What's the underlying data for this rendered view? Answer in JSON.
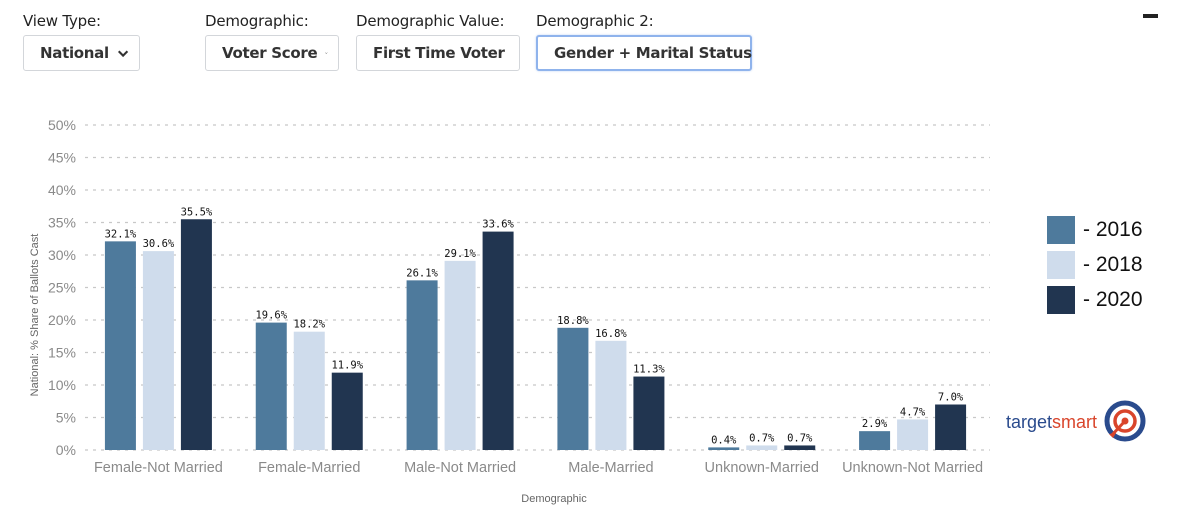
{
  "filters": [
    {
      "label": "View Type:",
      "value": "National"
    },
    {
      "label": "Demographic:",
      "value": "Voter Score"
    },
    {
      "label": "Demographic Value:",
      "value": "First Time Voter"
    },
    {
      "label": "Demographic 2:",
      "value": "Gender + Marital Status"
    }
  ],
  "window": {
    "minimize_icon": "minimize-icon"
  },
  "colors": {
    "s2016": "#4e7a9c",
    "s2018": "#cfdcec",
    "s2020": "#213550",
    "grid": "#c8c8c8",
    "axis_text": "#8a8a8a",
    "logo_blue": "#2a4b8d",
    "logo_red": "#d9452b"
  },
  "logo": {
    "part1": "target",
    "part2": "smart",
    "icon": "target-icon"
  },
  "chart_data": {
    "type": "bar",
    "title": "",
    "xlabel": "Demographic",
    "ylabel": "National: % Share of Ballots Cast",
    "ylim": [
      0,
      50
    ],
    "yticks": [
      "0%",
      "5%",
      "10%",
      "15%",
      "20%",
      "25%",
      "30%",
      "35%",
      "40%",
      "45%",
      "50%"
    ],
    "grid": true,
    "legend_position": "right",
    "categories": [
      "Female-Not Married",
      "Female-Married",
      "Male-Not Married",
      "Male-Married",
      "Unknown-Married",
      "Unknown-Not Married"
    ],
    "series": [
      {
        "name": "- 2016",
        "key": "s2016",
        "values": [
          32.1,
          19.6,
          26.1,
          18.8,
          0.4,
          2.9
        ],
        "labels": [
          "32.1%",
          "19.6%",
          "26.1%",
          "18.8%",
          "0.4%",
          "2.9%"
        ]
      },
      {
        "name": "- 2018",
        "key": "s2018",
        "values": [
          30.6,
          18.2,
          29.1,
          16.8,
          0.7,
          4.7
        ],
        "labels": [
          "30.6%",
          "18.2%",
          "29.1%",
          "16.8%",
          "0.7%",
          "4.7%"
        ]
      },
      {
        "name": "- 2020",
        "key": "s2020",
        "values": [
          35.5,
          11.9,
          33.6,
          11.3,
          0.7,
          7.0
        ],
        "labels": [
          "35.5%",
          "11.9%",
          "33.6%",
          "11.3%",
          "0.7%",
          "7.0%"
        ]
      }
    ]
  }
}
